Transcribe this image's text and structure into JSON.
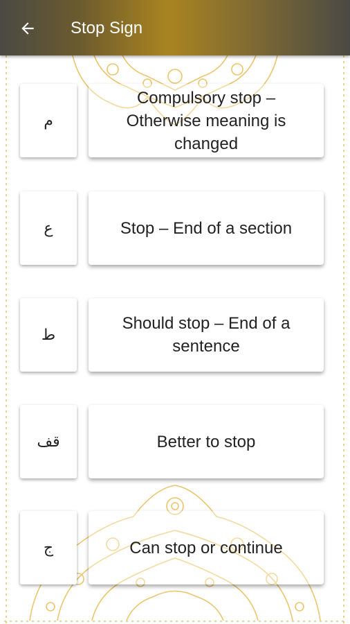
{
  "appbar": {
    "title": "Stop Sign",
    "back_icon": "arrow-left-icon"
  },
  "signs": [
    {
      "symbol": "م",
      "meaning": "Compulsory stop – Otherwise meaning is changed"
    },
    {
      "symbol": "ع",
      "meaning": "Stop – End of a section"
    },
    {
      "symbol": "ط",
      "meaning": "Should stop – End of a sentence"
    },
    {
      "symbol": "قف",
      "meaning": "Better to stop"
    },
    {
      "symbol": "ج",
      "meaning": "Can stop or continue"
    }
  ],
  "colors": {
    "appbar_gold": "#a98420",
    "ornament": "#e8c46a",
    "text": "#222222"
  }
}
